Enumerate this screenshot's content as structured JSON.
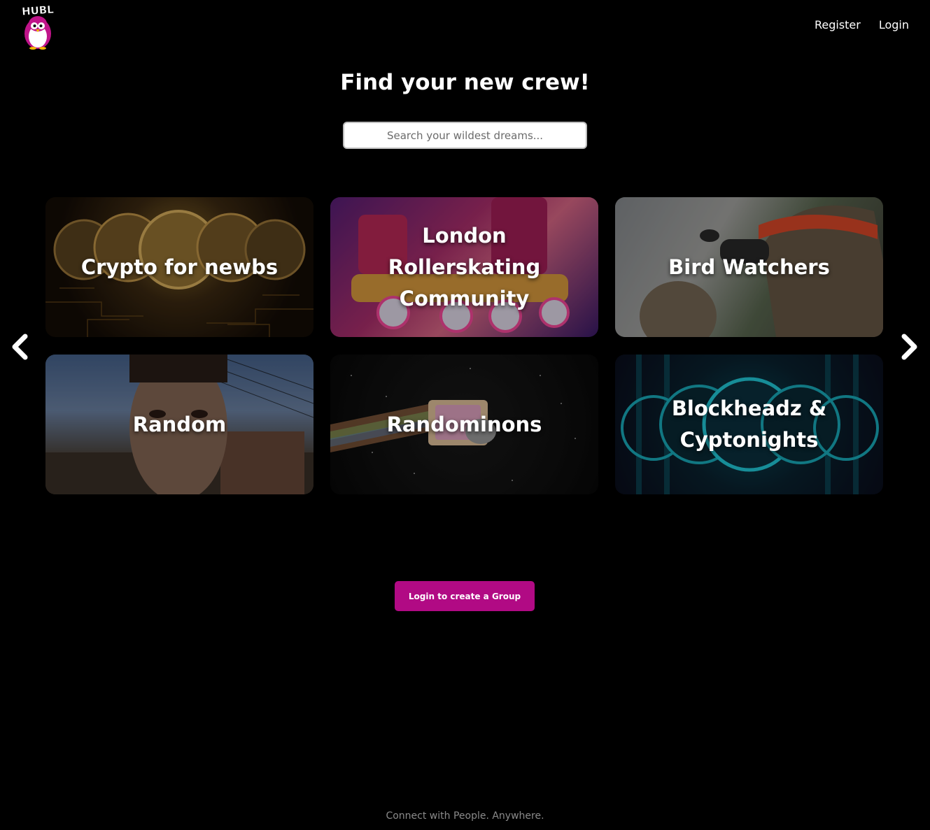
{
  "header": {
    "logo_text": "HUBL",
    "nav": [
      {
        "label": "Register"
      },
      {
        "label": "Login"
      }
    ]
  },
  "hero": {
    "title": "Find your new crew!",
    "search_placeholder": "Search your wildest dreams..."
  },
  "carousel": {
    "prev_icon": "chevron-left-icon",
    "next_icon": "chevron-right-icon",
    "groups": [
      {
        "name": "Crypto for newbs"
      },
      {
        "name": "London Rollerskating Community"
      },
      {
        "name": "Bird Watchers"
      },
      {
        "name": "Random"
      },
      {
        "name": "Randominons"
      },
      {
        "name": "Blockheadz & Cyptonights"
      }
    ]
  },
  "cta": {
    "label": "Login to create a Group"
  },
  "footer": {
    "text": "Connect with People. Anywhere."
  },
  "colors": {
    "background": "#000000",
    "accent": "#b10a84",
    "text": "#ffffff",
    "footer_text": "#8a8a8a"
  }
}
